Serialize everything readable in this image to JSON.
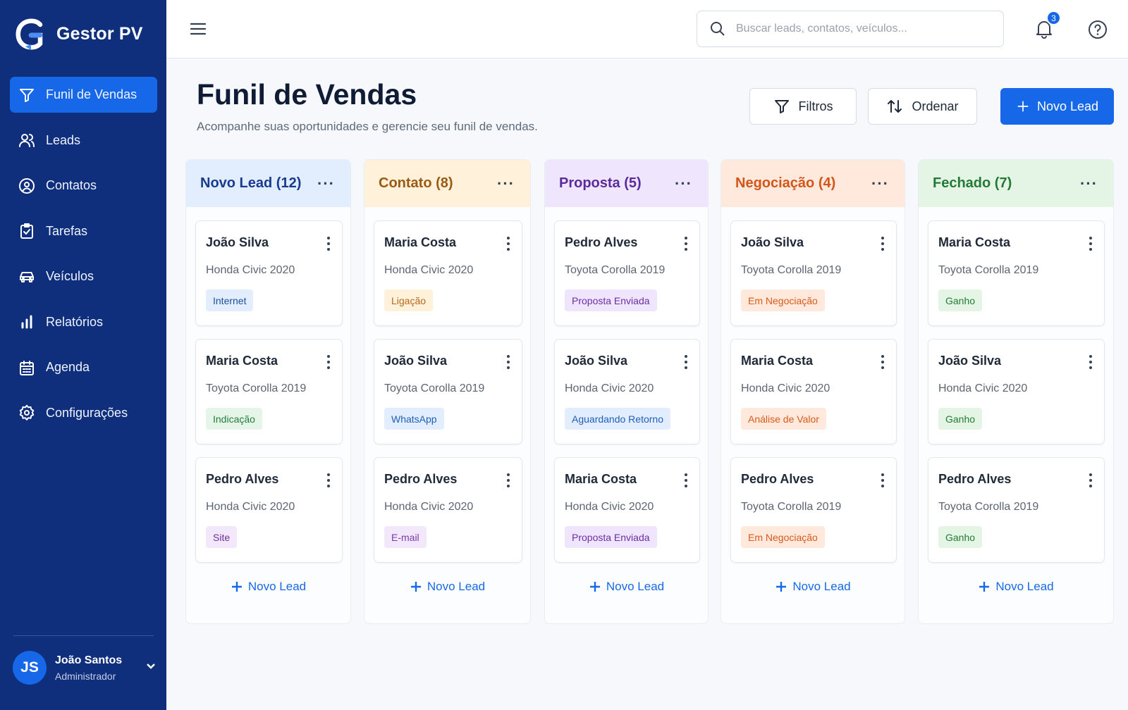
{
  "app": {
    "name": "Gestor PV"
  },
  "sidebar": {
    "items": [
      {
        "label": "Funil de Vendas",
        "icon": "funnel-icon"
      },
      {
        "label": "Leads",
        "icon": "users-icon"
      },
      {
        "label": "Contatos",
        "icon": "contact-icon"
      },
      {
        "label": "Tarefas",
        "icon": "clipboard-check-icon"
      },
      {
        "label": "Veículos",
        "icon": "car-icon"
      },
      {
        "label": "Relatórios",
        "icon": "bar-chart-icon"
      },
      {
        "label": "Agenda",
        "icon": "calendar-icon"
      },
      {
        "label": "Configurações",
        "icon": "gear-icon"
      }
    ]
  },
  "user": {
    "initials": "JS",
    "name": "João Santos",
    "role": "Administrador"
  },
  "search": {
    "placeholder": "Buscar leads, contatos, veículos..."
  },
  "notifications": {
    "count": "3"
  },
  "page": {
    "title": "Funil de Vendas",
    "subtitle": "Acompanhe suas oportunidades e gerencie seu funil de vendas."
  },
  "toolbar": {
    "filters": "Filtros",
    "sort": "Ordenar",
    "new_lead": "Novo Lead"
  },
  "colors": {
    "sidebar": "#0f2f7c",
    "accent": "#1768e8"
  },
  "columns": [
    {
      "title": "Novo Lead (12)",
      "title_color": "#183a8f",
      "header_bg": "#e2edfe",
      "more": "···",
      "add_label": "Novo Lead",
      "cards": [
        {
          "name": "João Silva",
          "vehicle": "Honda Civic 2020",
          "tag": "Internet",
          "tag_bg": "#e2edfe",
          "tag_fg": "#1f4f99"
        },
        {
          "name": "Maria Costa",
          "vehicle": "Toyota Corolla 2019",
          "tag": "Indicação",
          "tag_bg": "#e5f6e9",
          "tag_fg": "#247b39"
        },
        {
          "name": "Pedro Alves",
          "vehicle": "Honda Civic 2020",
          "tag": "Site",
          "tag_bg": "#f3e8fb",
          "tag_fg": "#6d2f95"
        }
      ]
    },
    {
      "title": "Contato (8)",
      "title_color": "#9a5a14",
      "header_bg": "#fff1da",
      "more": "···",
      "add_label": "Novo Lead",
      "cards": [
        {
          "name": "Maria Costa",
          "vehicle": "Honda Civic 2020",
          "tag": "Ligação",
          "tag_bg": "#fff1da",
          "tag_fg": "#b56a1b"
        },
        {
          "name": "João Silva",
          "vehicle": "Toyota Corolla 2019",
          "tag": "WhatsApp",
          "tag_bg": "#e2edfe",
          "tag_fg": "#1f5fb4"
        },
        {
          "name": "Pedro Alves",
          "vehicle": "Honda Civic 2020",
          "tag": "E-mail",
          "tag_bg": "#f3e8fb",
          "tag_fg": "#7b3aa6"
        }
      ]
    },
    {
      "title": "Proposta (5)",
      "title_color": "#5b2b9c",
      "header_bg": "#efe5fc",
      "more": "···",
      "add_label": "Novo Lead",
      "cards": [
        {
          "name": "Pedro Alves",
          "vehicle": "Toyota Corolla 2019",
          "tag": "Proposta Enviada",
          "tag_bg": "#efe5fc",
          "tag_fg": "#6b2fa2"
        },
        {
          "name": "João Silva",
          "vehicle": "Honda Civic 2020",
          "tag": "Aguardando Retorno",
          "tag_bg": "#e2edfe",
          "tag_fg": "#1f5fb4"
        },
        {
          "name": "Maria Costa",
          "vehicle": "Honda Civic 2020",
          "tag": "Proposta Enviada",
          "tag_bg": "#efe5fc",
          "tag_fg": "#6b2fa2"
        }
      ]
    },
    {
      "title": "Negociação (4)",
      "title_color": "#d45519",
      "header_bg": "#ffe9dc",
      "more": "···",
      "add_label": "Novo Lead",
      "cards": [
        {
          "name": "João Silva",
          "vehicle": "Toyota Corolla 2019",
          "tag": "Em Negociação",
          "tag_bg": "#ffe9dc",
          "tag_fg": "#d65a19"
        },
        {
          "name": "Maria Costa",
          "vehicle": "Honda Civic 2020",
          "tag": "Análise de Valor",
          "tag_bg": "#ffe9dc",
          "tag_fg": "#d65a19"
        },
        {
          "name": "Pedro Alves",
          "vehicle": "Toyota Corolla 2019",
          "tag": "Em Negociação",
          "tag_bg": "#ffe9dc",
          "tag_fg": "#d65a19"
        }
      ]
    },
    {
      "title": "Fechado (7)",
      "title_color": "#237a36",
      "header_bg": "#e4f5e6",
      "more": "···",
      "add_label": "Novo Lead",
      "cards": [
        {
          "name": "Maria Costa",
          "vehicle": "Toyota Corolla 2019",
          "tag": "Ganho",
          "tag_bg": "#e4f5e6",
          "tag_fg": "#237a36"
        },
        {
          "name": "João Silva",
          "vehicle": "Honda Civic 2020",
          "tag": "Ganho",
          "tag_bg": "#e4f5e6",
          "tag_fg": "#237a36"
        },
        {
          "name": "Pedro Alves",
          "vehicle": "Toyota Corolla 2019",
          "tag": "Ganho",
          "tag_bg": "#e4f5e6",
          "tag_fg": "#237a36"
        }
      ]
    }
  ]
}
